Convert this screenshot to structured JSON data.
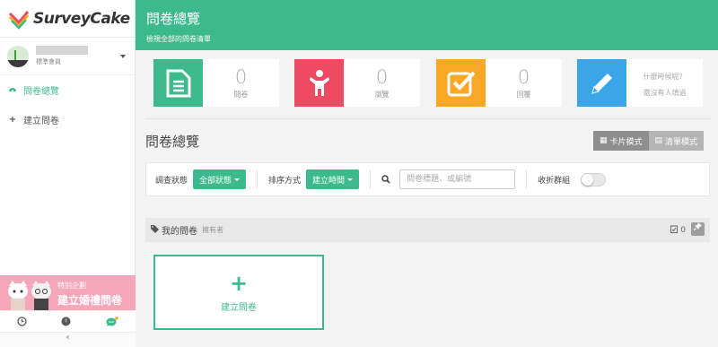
{
  "app": {
    "name": "SurveyCake"
  },
  "user": {
    "plan": "標準會員"
  },
  "sidebar": {
    "items": [
      {
        "label": "問卷總覽",
        "icon": "dashboard-icon",
        "active": true
      },
      {
        "label": "建立問卷",
        "icon": "plus-icon",
        "active": false
      }
    ],
    "promo": {
      "small": "特別企劃",
      "big": "建立婚禮問卷"
    },
    "collapse": "‹"
  },
  "header": {
    "title": "問卷總覽",
    "subtitle": "檢視全部的問卷清單"
  },
  "stats": [
    {
      "value": "0",
      "label": "問卷",
      "color": "#3dba8c",
      "icon": "document-icon"
    },
    {
      "value": "0",
      "label": "瀏覽",
      "color": "#ec4b63",
      "icon": "person-icon"
    },
    {
      "value": "0",
      "label": "回覆",
      "color": "#f9a825",
      "icon": "checkbox-icon"
    },
    {
      "hint1": "什麼時候呢？",
      "hint2": "還沒有人填過",
      "color": "#3aa6e8",
      "icon": "pencil-icon"
    }
  ],
  "section": {
    "title": "問卷總覽"
  },
  "view": {
    "card": "卡片模式",
    "list": "清單模式"
  },
  "filter": {
    "status_label": "調查狀態",
    "status_value": "全部狀態",
    "sort_label": "排序方式",
    "sort_value": "建立時間",
    "search_placeholder": "問卷標題、或編號",
    "collapse_label": "收折群組"
  },
  "group": {
    "title": "我的問卷",
    "owner": "擁有者",
    "count": "0"
  },
  "create": {
    "label": "建立問卷",
    "plus": "+"
  },
  "colors": {
    "accent": "#3dba8c"
  }
}
